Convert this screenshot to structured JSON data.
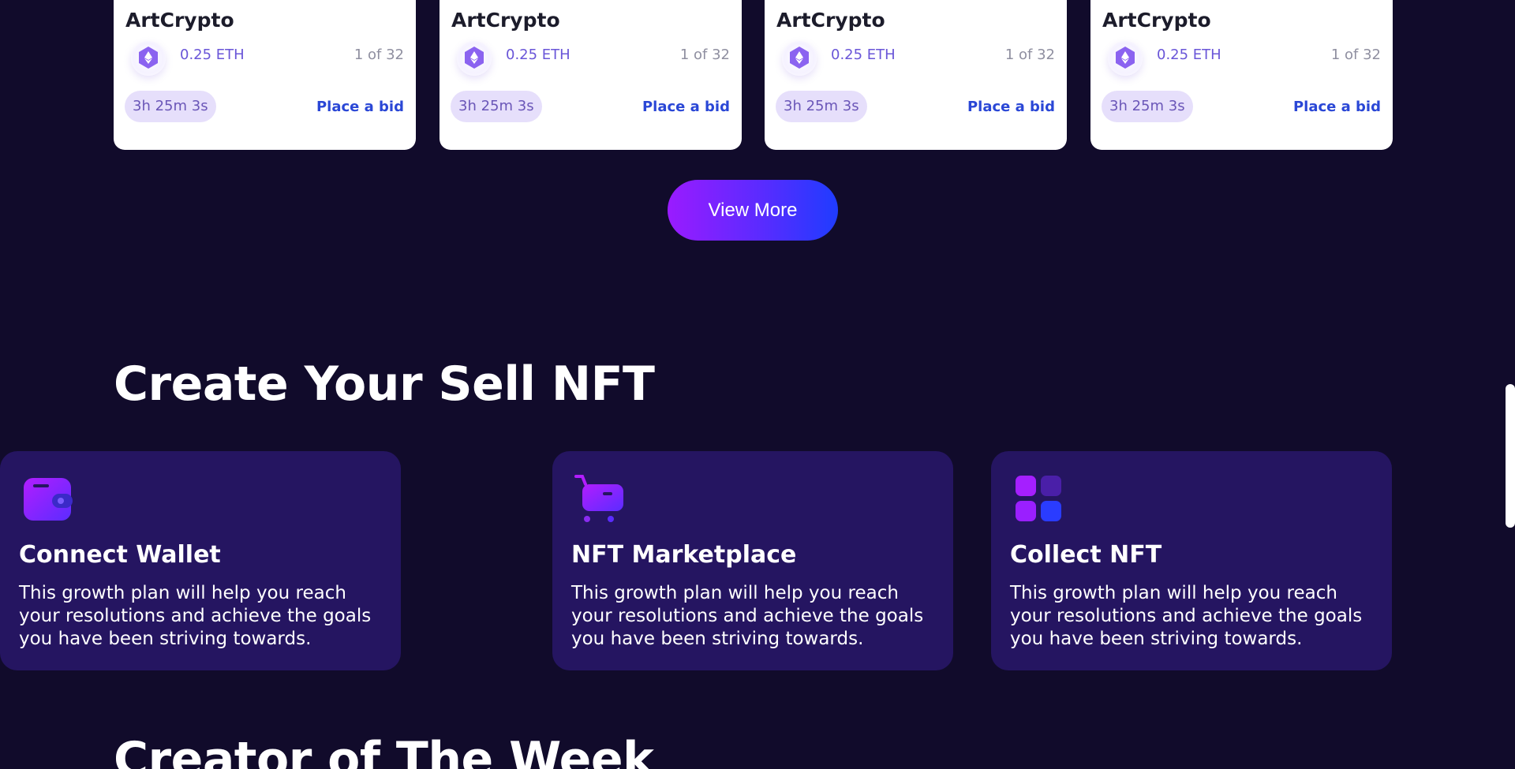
{
  "nft_cards": [
    {
      "title": "ArtCrypto",
      "price": "0.25 ETH",
      "edition": "1 of 32",
      "timer": "3h 25m 3s",
      "bid_label": "Place a bid"
    },
    {
      "title": "ArtCrypto",
      "price": "0.25 ETH",
      "edition": "1 of 32",
      "timer": "3h 25m 3s",
      "bid_label": "Place a bid"
    },
    {
      "title": "ArtCrypto",
      "price": "0.25 ETH",
      "edition": "1 of 32",
      "timer": "3h 25m 3s",
      "bid_label": "Place a bid"
    },
    {
      "title": "ArtCrypto",
      "price": "0.25 ETH",
      "edition": "1 of 32",
      "timer": "3h 25m 3s",
      "bid_label": "Place a bid"
    }
  ],
  "view_more_label": "View More",
  "create_section": {
    "title": "Create Your Sell NFT",
    "features": [
      {
        "icon": "wallet-icon",
        "title": "Connect Wallet",
        "description": "This growth plan will help you reach your resolutions and achieve the goals you have been striving towards."
      },
      {
        "icon": "cart-icon",
        "title": "NFT Marketplace",
        "description": "This growth plan will help you reach your resolutions and achieve the goals you have been striving towards."
      },
      {
        "icon": "grid-icon",
        "title": "Collect NFT",
        "description": "This growth plan will help you reach your resolutions and achieve the goals you have been striving towards."
      }
    ]
  },
  "creator_section": {
    "title": "Creator of The Week"
  },
  "colors": {
    "background": "#110b2b",
    "card": "#ffffff",
    "feature_card": "#251561",
    "accent_purple": "#9a1bff",
    "accent_blue": "#1f3cff",
    "bid_link": "#2a47d6",
    "price": "#6a56d8"
  }
}
